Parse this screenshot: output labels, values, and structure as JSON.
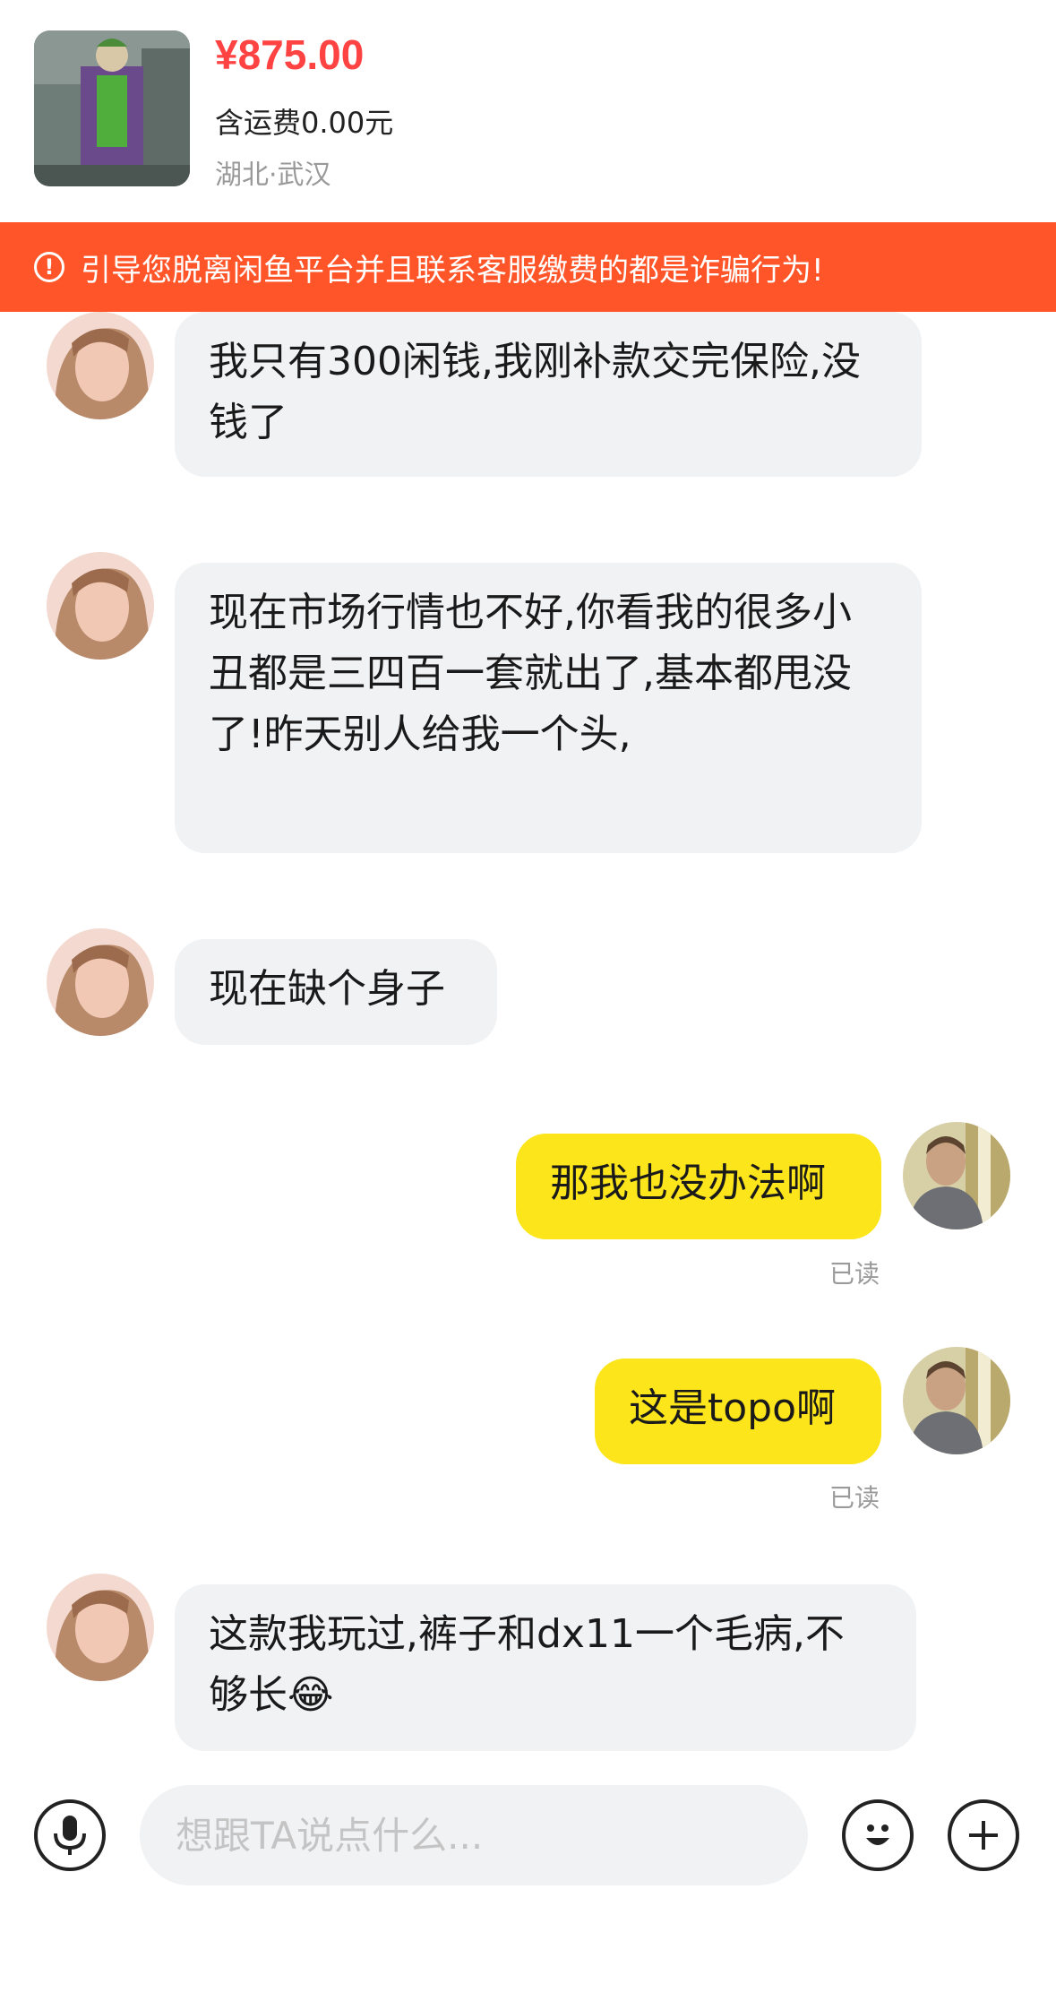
{
  "product": {
    "price": "¥875.00",
    "shipping": "含运费0.00元",
    "location": "湖北·武汉"
  },
  "warning": {
    "icon": "exclamation-circle-icon",
    "text": "引导您脱离闲鱼平台并且联系客服缴费的都是诈骗行为!"
  },
  "messages": [
    {
      "from": "other",
      "text": "我只有300闲钱,我刚补款交完保险,没钱了"
    },
    {
      "from": "other",
      "text": "现在市场行情也不好,你看我的很多小丑都是三四百一套就出了,基本都甩没了!昨天别人给我一个头,"
    },
    {
      "from": "other",
      "text": "现在缺个身子"
    },
    {
      "from": "me",
      "text": "那我也没办法啊",
      "status": "已读"
    },
    {
      "from": "me",
      "text": "这是topo啊",
      "status": "已读"
    },
    {
      "from": "other",
      "text": "这款我玩过,裤子和dx11一个毛病,不够长😂"
    }
  ],
  "input": {
    "placeholder": "想跟TA说点什么...",
    "voice_icon": "microphone-icon",
    "emoji_icon": "smiley-icon",
    "add_icon": "plus-icon"
  },
  "colors": {
    "price": "#ff4242",
    "banner": "#ff5528",
    "my_bubble": "#fce51a",
    "other_bubble": "#f1f2f4"
  }
}
